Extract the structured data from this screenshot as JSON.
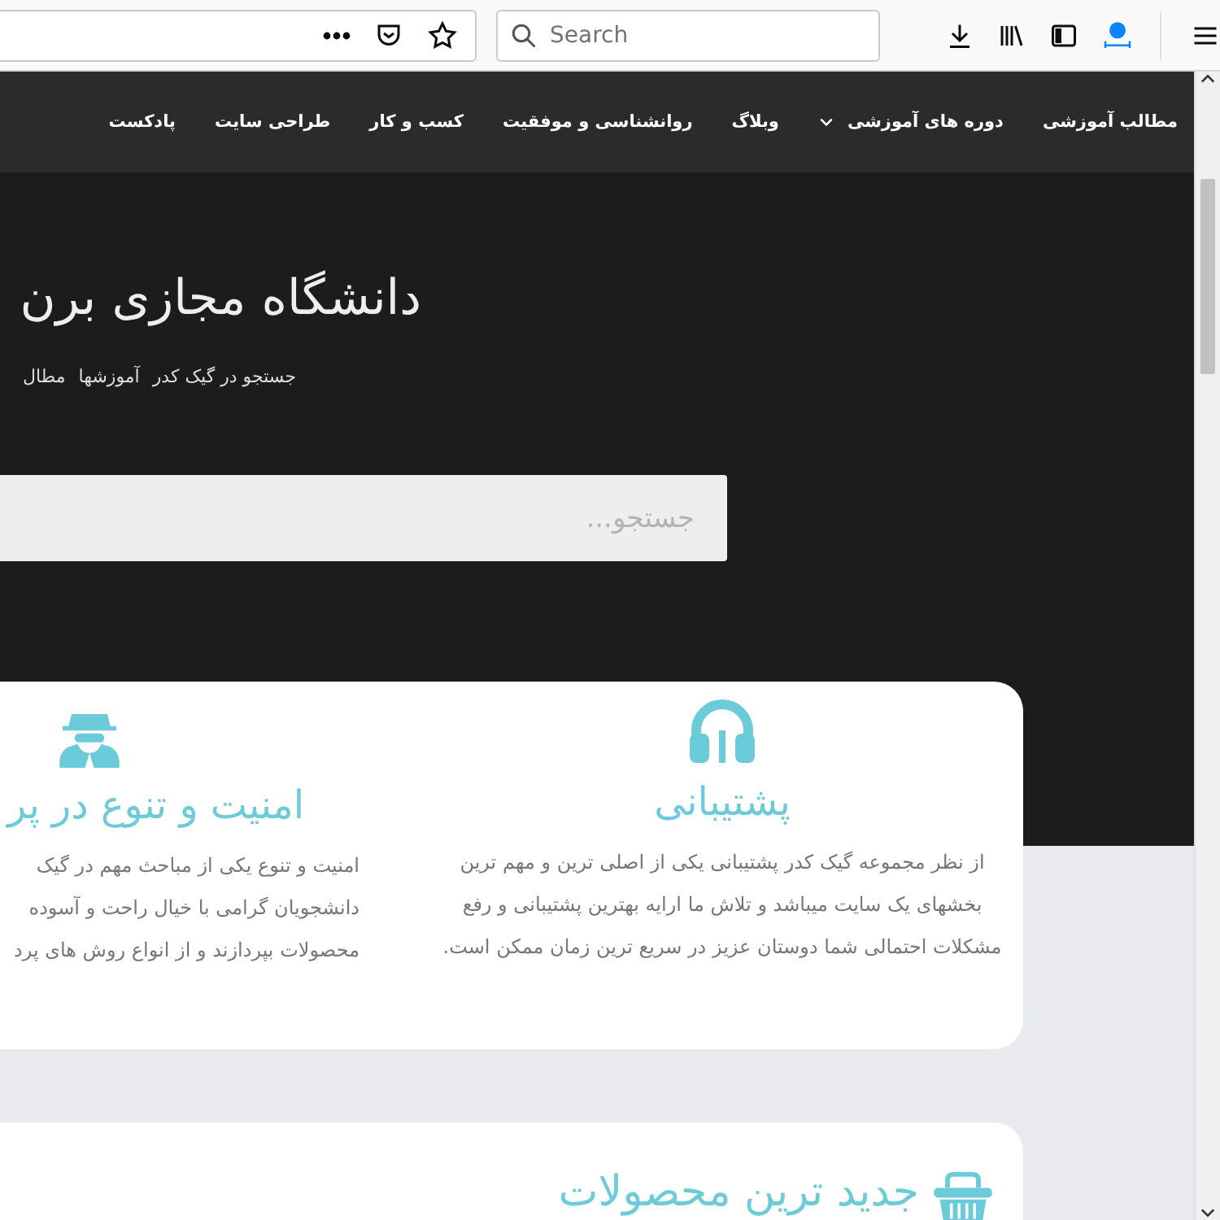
{
  "browser": {
    "search": {
      "placeholder": "Search"
    }
  },
  "nav": {
    "items": [
      {
        "label": "مطالب آموزشی",
        "dropdown": false
      },
      {
        "label": "دوره های آموزشی",
        "dropdown": true
      },
      {
        "label": "وبلاگ",
        "dropdown": false
      },
      {
        "label": "روانشناسی و موفقیت",
        "dropdown": false
      },
      {
        "label": "کسب و کار",
        "dropdown": false
      },
      {
        "label": "طراحی سایت",
        "dropdown": false
      },
      {
        "label": "پادکست",
        "dropdown": false
      }
    ]
  },
  "hero": {
    "title": "دانشگاه مجازی برن",
    "breadcrumb": [
      "جستجو در گیک کدر",
      "آموزشها",
      "مطال"
    ],
    "search": {
      "placeholder": "جستجو..."
    }
  },
  "features": [
    {
      "kind": "support",
      "title": "پشتیبانی",
      "text": "از نظر مجموعه گیک کدر پشتیبانی یکی از اصلی ترین و مهم ترین بخشهای یک سایت میباشد و تلاش ما ارایه بهترین پشتیبانی و رفع مشکلات احتمالی شما دوستان عزیز در سریع ترین زمان ممکن است."
    },
    {
      "kind": "security",
      "title": "امنیت و تنوع در پر",
      "lines": [
        "امنیت و تنوع یکی از مباحث مهم در گیک",
        "دانشجویان گرامی با خیال راحت و آسوده",
        "محصولات بپردازند و از انواع روش های پرد"
      ]
    }
  ],
  "latest": {
    "title": "جدید ترین محصولات"
  }
}
